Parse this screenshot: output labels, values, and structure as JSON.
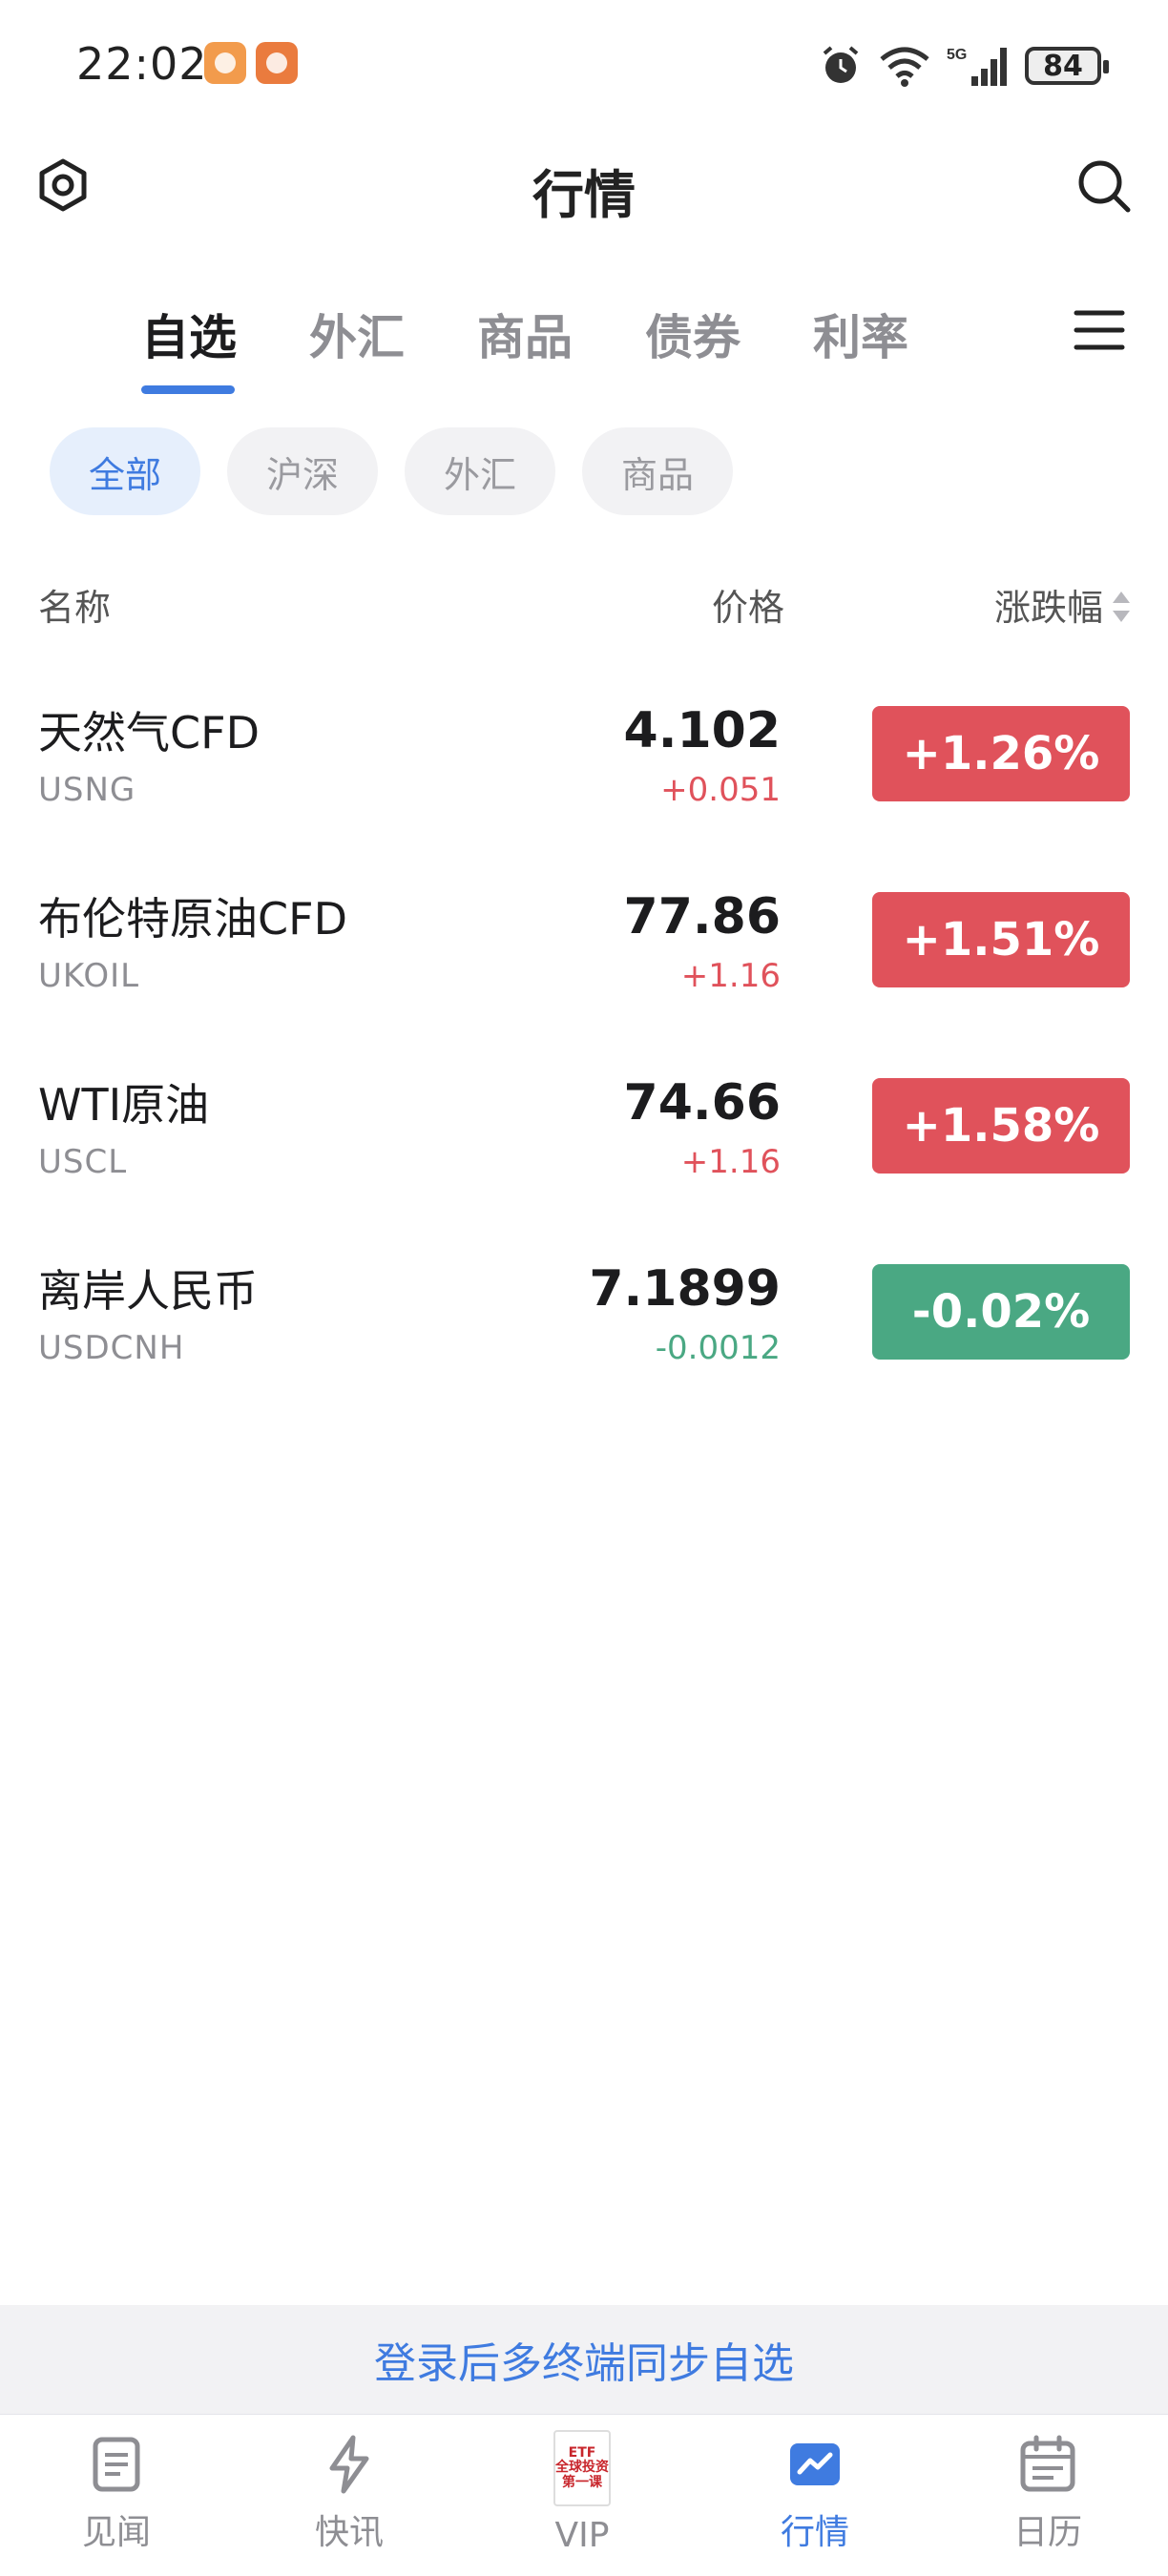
{
  "status_bar": {
    "time": "22:02",
    "battery": "84"
  },
  "header": {
    "title": "行情"
  },
  "tabs": [
    {
      "label": "自选",
      "active": true
    },
    {
      "label": "外汇",
      "active": false
    },
    {
      "label": "商品",
      "active": false
    },
    {
      "label": "债券",
      "active": false
    },
    {
      "label": "利率",
      "active": false
    }
  ],
  "filters": [
    {
      "label": "全部",
      "active": true
    },
    {
      "label": "沪深",
      "active": false
    },
    {
      "label": "外汇",
      "active": false
    },
    {
      "label": "商品",
      "active": false
    }
  ],
  "columns": {
    "name": "名称",
    "price": "价格",
    "change": "涨跌幅"
  },
  "rows": [
    {
      "name": "天然气CFD",
      "code": "USNG",
      "price": "4.102",
      "delta": "+0.051",
      "change": "+1.26%",
      "direction": "up"
    },
    {
      "name": "布伦特原油CFD",
      "code": "UKOIL",
      "price": "77.86",
      "delta": "+1.16",
      "change": "+1.51%",
      "direction": "up"
    },
    {
      "name": "WTI原油",
      "code": "USCL",
      "price": "74.66",
      "delta": "+1.16",
      "change": "+1.58%",
      "direction": "up"
    },
    {
      "name": "离岸人民币",
      "code": "USDCNH",
      "price": "7.1899",
      "delta": "-0.0012",
      "change": "-0.02%",
      "direction": "down"
    }
  ],
  "sync_banner": "登录后多终端同步自选",
  "bottom_nav": [
    {
      "label": "见闻",
      "icon": "document-icon",
      "active": false
    },
    {
      "label": "快讯",
      "icon": "lightning-icon",
      "active": false
    },
    {
      "label": "VIP",
      "icon": "book-cover-icon",
      "active": false,
      "cover_lines": [
        "ETF",
        "全球投资",
        "第一课"
      ]
    },
    {
      "label": "行情",
      "icon": "chart-icon",
      "active": true
    },
    {
      "label": "日历",
      "icon": "calendar-icon",
      "active": false
    }
  ],
  "colors": {
    "up": "#e0525b",
    "down": "#4aa883",
    "accent": "#3f7be0"
  }
}
